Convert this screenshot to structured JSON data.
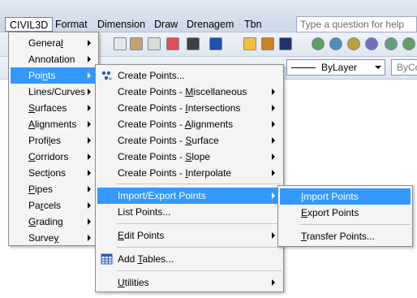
{
  "menubar": {
    "items": [
      "CIVIL3D",
      "Format",
      "Dimension",
      "Draw",
      "Drenagem",
      "Tbn"
    ],
    "help_placeholder": "Type a question for help"
  },
  "toolbar": {
    "layer_value": "ByLayer",
    "color_value": "ByCo"
  },
  "civil3d_menu": {
    "items": [
      {
        "pre": "Genera",
        "u": "l",
        "post": ""
      },
      {
        "pre": "Annotation",
        "u": "",
        "post": ""
      },
      {
        "pre": "Poi",
        "u": "n",
        "post": "ts"
      },
      {
        "pre": "Lines/Curves",
        "u": "",
        "post": ""
      },
      {
        "pre": "",
        "u": "S",
        "post": "urfaces"
      },
      {
        "pre": "",
        "u": "A",
        "post": "lignments"
      },
      {
        "pre": "Profi",
        "u": "l",
        "post": "es"
      },
      {
        "pre": "",
        "u": "C",
        "post": "orridors"
      },
      {
        "pre": "Sect",
        "u": "i",
        "post": "ons"
      },
      {
        "pre": "",
        "u": "P",
        "post": "ipes"
      },
      {
        "pre": "Pa",
        "u": "r",
        "post": "cels"
      },
      {
        "pre": "",
        "u": "G",
        "post": "rading"
      },
      {
        "pre": "Surve",
        "u": "y",
        "post": ""
      }
    ]
  },
  "points_menu": {
    "items": [
      {
        "pre": "Create Points...",
        "u": "",
        "post": ""
      },
      {
        "pre": "Create Points - ",
        "u": "M",
        "post": "iscellaneous"
      },
      {
        "pre": "Create Points - ",
        "u": "I",
        "post": "ntersections"
      },
      {
        "pre": "Create Points - ",
        "u": "A",
        "post": "lignments"
      },
      {
        "pre": "Create Points - ",
        "u": "S",
        "post": "urface"
      },
      {
        "pre": "Create Points - ",
        "u": "S",
        "post": "lope"
      },
      {
        "pre": "Create Points - ",
        "u": "I",
        "post": "nterpolate"
      },
      {
        "pre": "Import/Export Points",
        "u": "",
        "post": ""
      },
      {
        "pre": "List Points...",
        "u": "",
        "post": ""
      },
      {
        "pre": "",
        "u": "E",
        "post": "dit Points"
      },
      {
        "pre": "Add ",
        "u": "T",
        "post": "ables..."
      },
      {
        "pre": "",
        "u": "U",
        "post": "tilities"
      }
    ]
  },
  "import_export_menu": {
    "items": [
      {
        "pre": "",
        "u": "I",
        "post": "mport Points"
      },
      {
        "pre": "",
        "u": "E",
        "post": "xport Points"
      },
      {
        "pre": "",
        "u": "T",
        "post": "ransfer Points..."
      }
    ]
  },
  "colors": {
    "highlight": "#3399ff",
    "menu_bg": "#f4f4f4",
    "menubar_bg": "#d6dfec"
  }
}
